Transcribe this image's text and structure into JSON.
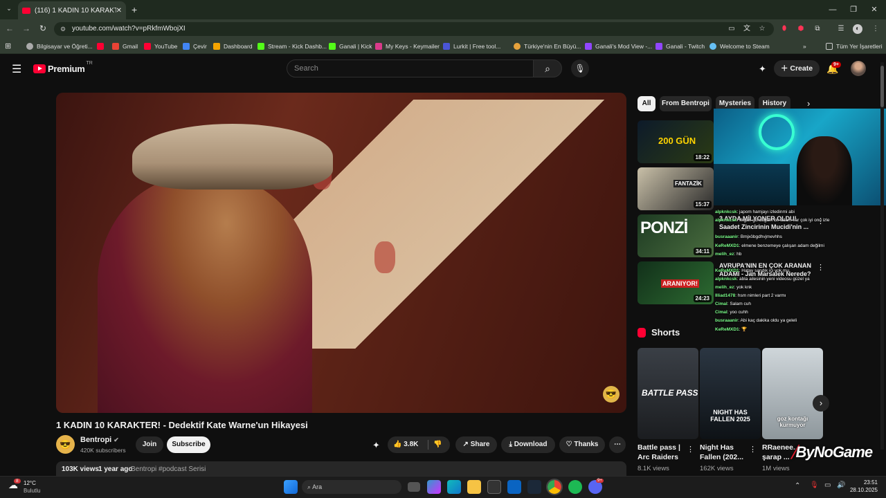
{
  "browser": {
    "tab_title": "(116) 1 KADIN 10 KARAKTER! -",
    "url": "youtube.com/watch?v=pRkfmWbojXI",
    "bookmarks": [
      {
        "label": "Bilgisayar ve Öğreti..."
      },
      {
        "label": ""
      },
      {
        "label": "Gmail"
      },
      {
        "label": "YouTube"
      },
      {
        "label": "Çevir"
      },
      {
        "label": "Dashboard"
      },
      {
        "label": "Stream - Kick Dashb..."
      },
      {
        "label": "Ganali | Kick"
      },
      {
        "label": "My Keys - Keymailer"
      },
      {
        "label": "Lurkit | Free tool..."
      },
      {
        "label": "Türkiye'nin En Büyü..."
      },
      {
        "label": "Ganali's Mod View -..."
      },
      {
        "label": "Ganali - Twitch"
      },
      {
        "label": "Welcome to Steam"
      }
    ],
    "all_bookmarks": "Tüm Yer İşaretleri"
  },
  "yt_header": {
    "logo": "Premium",
    "region": "TR",
    "search_placeholder": "Search",
    "create_label": "Create",
    "notif_badge": "9+"
  },
  "video": {
    "title": "1 KADIN 10 KARAKTER! - Dedektif Kate Warne'un Hikayesi",
    "channel": "Bentropi",
    "subscribers": "420K subscribers",
    "join": "Join",
    "subscribe": "Subscribe",
    "likes": "3.8K",
    "share": "Share",
    "download": "Download",
    "thanks": "Thanks",
    "views": "103K views",
    "age": "1 year ago",
    "desc_tags": "Bentropi #podcast Serisi"
  },
  "chips": [
    "All",
    "From Bentropi",
    "Mysteries",
    "History"
  ],
  "recommendations": [
    {
      "duration": "18:22",
      "thumb_text": "200 GÜN"
    },
    {
      "duration": "15:37",
      "thumb_text": "FANTAZİK"
    },
    {
      "duration": "34:11",
      "thumb_text": "PONZİ"
    },
    {
      "duration": "24:23",
      "thumb_text": "ARANIYOR!"
    }
  ],
  "rec_titles": [
    "3 AYDA MİLYONER OLDU!",
    "Saadet Zincirinin Mucidi'nin ...",
    "AVRUPA'NIN EN ÇOK ARANAN",
    "ADAMI - Jan Marsalek Nerede?"
  ],
  "chat_lines": [
    {
      "user": "alpknkcsk",
      "msg": ": japom hamjayı izledinmi abi"
    },
    {
      "user": "alpknkcsk",
      "msg": ": ılkgan gördüğüm bir adam var çok iyi onu izle"
    },
    {
      "user": "busraaanir",
      "msg": ": Bmjxöbgdhvjmevhhs"
    },
    {
      "user": "KeReMXD1",
      "msg": ": elmene benzemeye çalışan adam değilmi"
    },
    {
      "user": "melih_ez",
      "msg": ": hb"
    },
    {
      "user": "KeReMXD1",
      "msg": ": Hatay sandık içi yok mu"
    },
    {
      "user": "alpknkcsk",
      "msg": ": abla ailesinin yeni videosu güzel ya"
    },
    {
      "user": "melih_ez",
      "msg": ": yok knk"
    },
    {
      "user": "Illiad1478",
      "msg": ": hsm nimleri part 2 varmı"
    },
    {
      "user": "Cimal",
      "msg": ": Salam cuh"
    },
    {
      "user": "Cimal",
      "msg": ": yoo cuhh"
    },
    {
      "user": "busraaanir",
      "msg": ": Abi kaç dakika oldu ya geleli"
    },
    {
      "user": "KeReMXD1",
      "msg": ": 🏆"
    }
  ],
  "shorts": {
    "heading": "Shorts",
    "items": [
      {
        "title": "Battle pass | Arc Raiders",
        "views": "8.1K views",
        "thumb_text": "BATTLE PASS"
      },
      {
        "title": "Night Has Fallen (202...",
        "views": "162K views",
        "thumb_text": "NIGHT HAS FALLEN 2025"
      },
      {
        "title": "RRaenee... şarap ...",
        "views": "1M views",
        "thumb_text": "goz kontağı kurmuyor"
      }
    ]
  },
  "overlay_watermark": "ByNoGame",
  "taskbar": {
    "weather_temp": "12°C",
    "weather_desc": "Bulutlu",
    "weather_badge": "8",
    "search_label": "Ara",
    "time": "23:51",
    "date": "28.10.2025",
    "discord_badge": "9+"
  }
}
